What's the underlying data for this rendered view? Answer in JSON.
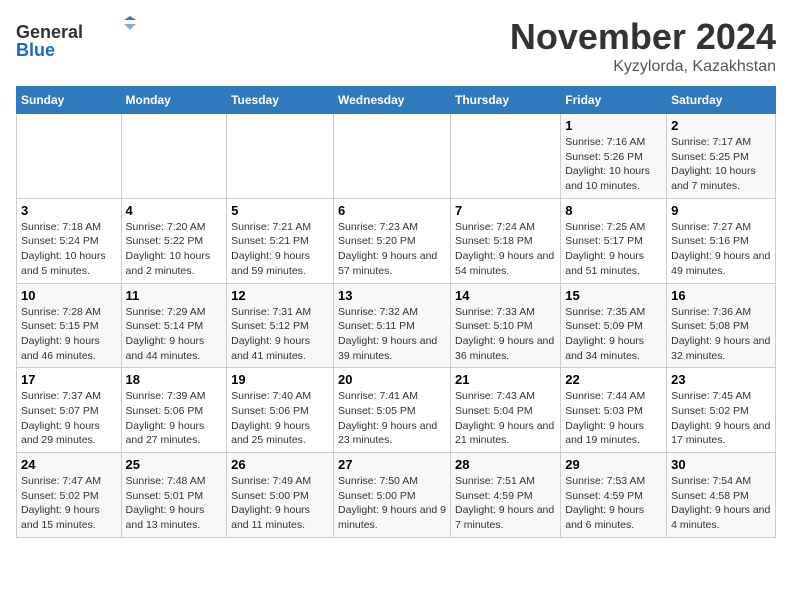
{
  "header": {
    "logo_general": "General",
    "logo_blue": "Blue",
    "month_title": "November 2024",
    "location": "Kyzylorda, Kazakhstan"
  },
  "weekdays": [
    "Sunday",
    "Monday",
    "Tuesday",
    "Wednesday",
    "Thursday",
    "Friday",
    "Saturday"
  ],
  "weeks": [
    [
      {
        "day": "",
        "info": ""
      },
      {
        "day": "",
        "info": ""
      },
      {
        "day": "",
        "info": ""
      },
      {
        "day": "",
        "info": ""
      },
      {
        "day": "",
        "info": ""
      },
      {
        "day": "1",
        "info": "Sunrise: 7:16 AM\nSunset: 5:26 PM\nDaylight: 10 hours and 10 minutes."
      },
      {
        "day": "2",
        "info": "Sunrise: 7:17 AM\nSunset: 5:25 PM\nDaylight: 10 hours and 7 minutes."
      }
    ],
    [
      {
        "day": "3",
        "info": "Sunrise: 7:18 AM\nSunset: 5:24 PM\nDaylight: 10 hours and 5 minutes."
      },
      {
        "day": "4",
        "info": "Sunrise: 7:20 AM\nSunset: 5:22 PM\nDaylight: 10 hours and 2 minutes."
      },
      {
        "day": "5",
        "info": "Sunrise: 7:21 AM\nSunset: 5:21 PM\nDaylight: 9 hours and 59 minutes."
      },
      {
        "day": "6",
        "info": "Sunrise: 7:23 AM\nSunset: 5:20 PM\nDaylight: 9 hours and 57 minutes."
      },
      {
        "day": "7",
        "info": "Sunrise: 7:24 AM\nSunset: 5:18 PM\nDaylight: 9 hours and 54 minutes."
      },
      {
        "day": "8",
        "info": "Sunrise: 7:25 AM\nSunset: 5:17 PM\nDaylight: 9 hours and 51 minutes."
      },
      {
        "day": "9",
        "info": "Sunrise: 7:27 AM\nSunset: 5:16 PM\nDaylight: 9 hours and 49 minutes."
      }
    ],
    [
      {
        "day": "10",
        "info": "Sunrise: 7:28 AM\nSunset: 5:15 PM\nDaylight: 9 hours and 46 minutes."
      },
      {
        "day": "11",
        "info": "Sunrise: 7:29 AM\nSunset: 5:14 PM\nDaylight: 9 hours and 44 minutes."
      },
      {
        "day": "12",
        "info": "Sunrise: 7:31 AM\nSunset: 5:12 PM\nDaylight: 9 hours and 41 minutes."
      },
      {
        "day": "13",
        "info": "Sunrise: 7:32 AM\nSunset: 5:11 PM\nDaylight: 9 hours and 39 minutes."
      },
      {
        "day": "14",
        "info": "Sunrise: 7:33 AM\nSunset: 5:10 PM\nDaylight: 9 hours and 36 minutes."
      },
      {
        "day": "15",
        "info": "Sunrise: 7:35 AM\nSunset: 5:09 PM\nDaylight: 9 hours and 34 minutes."
      },
      {
        "day": "16",
        "info": "Sunrise: 7:36 AM\nSunset: 5:08 PM\nDaylight: 9 hours and 32 minutes."
      }
    ],
    [
      {
        "day": "17",
        "info": "Sunrise: 7:37 AM\nSunset: 5:07 PM\nDaylight: 9 hours and 29 minutes."
      },
      {
        "day": "18",
        "info": "Sunrise: 7:39 AM\nSunset: 5:06 PM\nDaylight: 9 hours and 27 minutes."
      },
      {
        "day": "19",
        "info": "Sunrise: 7:40 AM\nSunset: 5:06 PM\nDaylight: 9 hours and 25 minutes."
      },
      {
        "day": "20",
        "info": "Sunrise: 7:41 AM\nSunset: 5:05 PM\nDaylight: 9 hours and 23 minutes."
      },
      {
        "day": "21",
        "info": "Sunrise: 7:43 AM\nSunset: 5:04 PM\nDaylight: 9 hours and 21 minutes."
      },
      {
        "day": "22",
        "info": "Sunrise: 7:44 AM\nSunset: 5:03 PM\nDaylight: 9 hours and 19 minutes."
      },
      {
        "day": "23",
        "info": "Sunrise: 7:45 AM\nSunset: 5:02 PM\nDaylight: 9 hours and 17 minutes."
      }
    ],
    [
      {
        "day": "24",
        "info": "Sunrise: 7:47 AM\nSunset: 5:02 PM\nDaylight: 9 hours and 15 minutes."
      },
      {
        "day": "25",
        "info": "Sunrise: 7:48 AM\nSunset: 5:01 PM\nDaylight: 9 hours and 13 minutes."
      },
      {
        "day": "26",
        "info": "Sunrise: 7:49 AM\nSunset: 5:00 PM\nDaylight: 9 hours and 11 minutes."
      },
      {
        "day": "27",
        "info": "Sunrise: 7:50 AM\nSunset: 5:00 PM\nDaylight: 9 hours and 9 minutes."
      },
      {
        "day": "28",
        "info": "Sunrise: 7:51 AM\nSunset: 4:59 PM\nDaylight: 9 hours and 7 minutes."
      },
      {
        "day": "29",
        "info": "Sunrise: 7:53 AM\nSunset: 4:59 PM\nDaylight: 9 hours and 6 minutes."
      },
      {
        "day": "30",
        "info": "Sunrise: 7:54 AM\nSunset: 4:58 PM\nDaylight: 9 hours and 4 minutes."
      }
    ]
  ]
}
